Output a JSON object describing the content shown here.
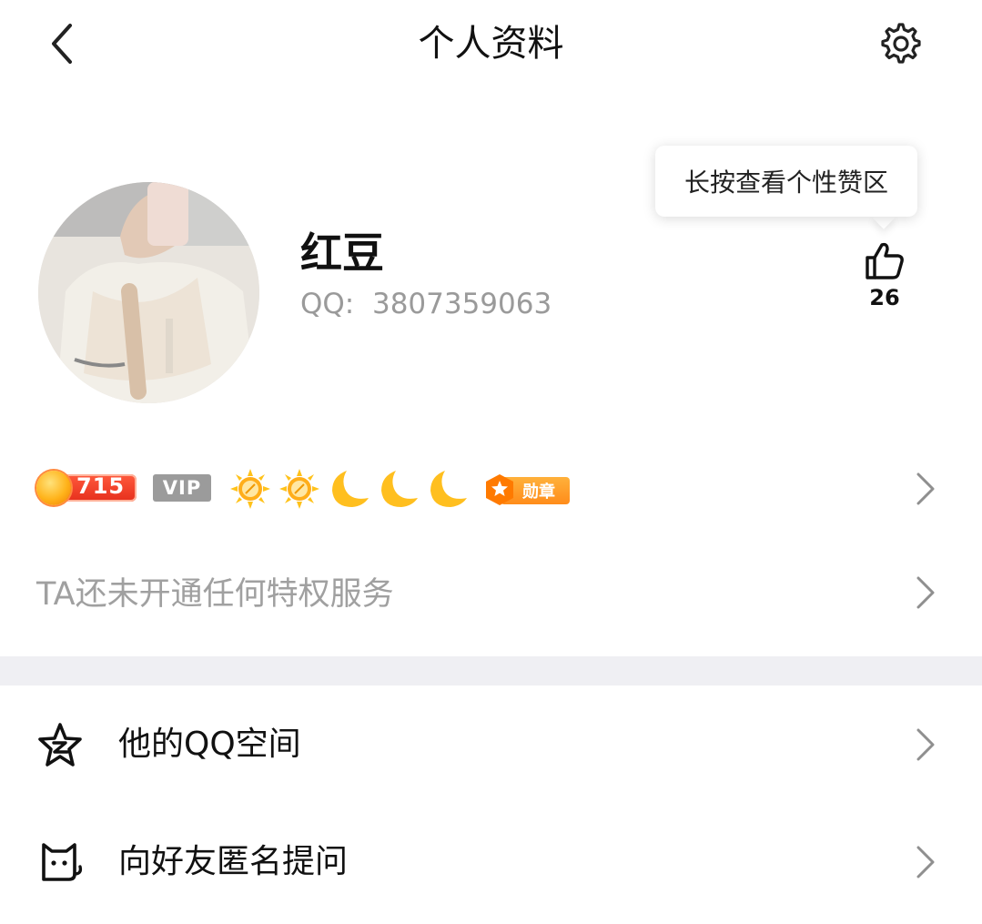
{
  "header": {
    "title": "个人资料",
    "back_icon": "back-arrow-icon",
    "settings_icon": "gear-icon"
  },
  "tooltip": {
    "text": "长按查看个性赞区"
  },
  "profile": {
    "nickname": "红豆",
    "qq_label": "QQ:",
    "qq_number": "3807359063",
    "like_count": "26"
  },
  "badges": {
    "level": "715",
    "vip": "VIP",
    "suns": 2,
    "moons": 3,
    "medal": "勋章"
  },
  "privilege": {
    "text": "TA还未开通任何特权服务"
  },
  "menu": {
    "items": [
      {
        "label": "他的QQ空间",
        "icon": "qzone-star-icon"
      },
      {
        "label": "向好友匿名提问",
        "icon": "cat-icon"
      }
    ]
  },
  "colors": {
    "divider": "#efeff3",
    "secondary_text": "#9a9a9a",
    "level_badge": "#e62f1c",
    "vip_badge": "#9b9b9b",
    "medal_badge": "#ff8c1a"
  }
}
